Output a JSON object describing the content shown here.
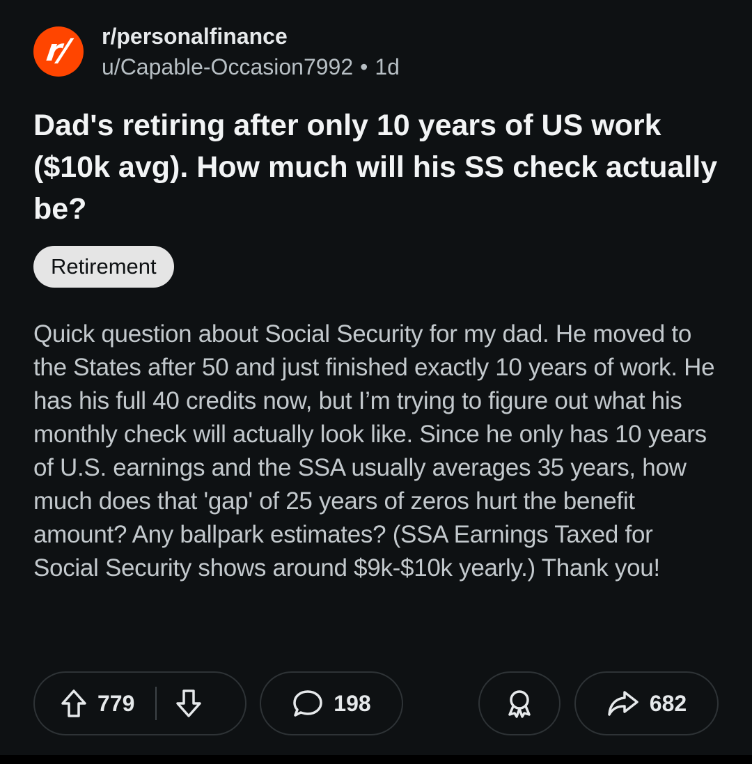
{
  "header": {
    "avatar_letter": "r/",
    "subreddit": "r/personalfinance",
    "username": "u/Capable-Occasion7992",
    "separator": "•",
    "age": "1d"
  },
  "post": {
    "title": "Dad's retiring after only 10 years of US work ($10k avg). How much will his SS check actually be?",
    "flair": "Retirement",
    "body": "Quick question about Social Security for my dad. He moved to the States after 50 and just finished exactly 10 years of work. He has his full 40 credits now, but I’m trying to figure out what his monthly check will actually look like. Since he only has 10 years of U.S. earnings and the SSA usually averages 35 years, how much does that 'gap' of 25 years of zeros hurt the benefit amount? Any ballpark estimates? (SSA Earnings Taxed for Social Security shows around $9k-$10k yearly.) Thank you!"
  },
  "actions": {
    "upvotes": "779",
    "comments": "198",
    "shares": "682"
  },
  "icons": {
    "avatar": "subreddit-avatar",
    "upvote": "arrow-up-icon",
    "downvote": "arrow-down-icon",
    "comment": "speech-bubble-icon",
    "award": "award-ribbon-icon",
    "share": "share-arrow-icon"
  },
  "colors": {
    "background": "#0e1113",
    "avatar": "#ff4500",
    "flair_bg": "#e5e5e5"
  }
}
